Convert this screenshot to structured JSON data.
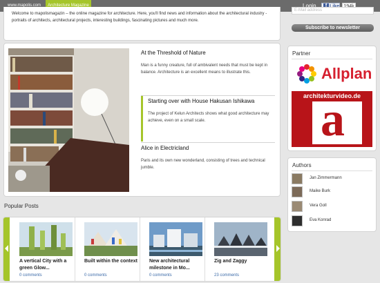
{
  "topbar": {
    "site_tab": "www.mapolis.com",
    "magazine_tab": "Architecture Magazine",
    "login": "Login",
    "fb_like": "Like",
    "fb_count": "194k"
  },
  "welcome": {
    "text": "Welcome to mapolismagazin – the online magazine for architecture. Here, you'll find news and information about the architectural industry - portraits of architects, architectural projects, interesting buildings, fascinating pictures and much more."
  },
  "newsletter": {
    "email_placeholder": "E-Mail address",
    "button": "Subscribe to newsletter"
  },
  "stories": [
    {
      "title": "At the Threshold of Nature",
      "text": "Man is a funny creature, full of ambivalent needs that must be kept in balance. Architecture is an excellent means to illustrate this."
    },
    {
      "title": "Starting over with House Hakusan Ishikawa",
      "text": "The project of Kelun Architects shows what good architecture may achieve, even on a small scale."
    },
    {
      "title": "Alice in Electricland",
      "text": "Paris and its own new wonderland, consisting of trees and technical jumble."
    }
  ],
  "partner": {
    "title": "Partner",
    "allplan": "Allplan",
    "archvideo": "architekturvideo.de",
    "archvideo_letter": "a"
  },
  "authors": {
    "title": "Authors",
    "items": [
      {
        "name": "Jan Zimmermann"
      },
      {
        "name": "Maike Burk"
      },
      {
        "name": "Vera Goll"
      },
      {
        "name": "Eva Konrad"
      }
    ]
  },
  "popular": {
    "title": "Popular Posts",
    "posts": [
      {
        "title": "A vertical City with a green Glow...",
        "comments": "0 comments"
      },
      {
        "title": "Built within the context",
        "comments": "0 comments"
      },
      {
        "title": "New architectural milestone in Mo...",
        "comments": "0 comments"
      },
      {
        "title": "Zig and Zaggy",
        "comments": "23 comments"
      }
    ]
  },
  "colors": {
    "accent": "#a5c52a",
    "topbar": "#6b6b6b",
    "allplan_red": "#d6202f",
    "archvideo_red": "#b81419"
  }
}
